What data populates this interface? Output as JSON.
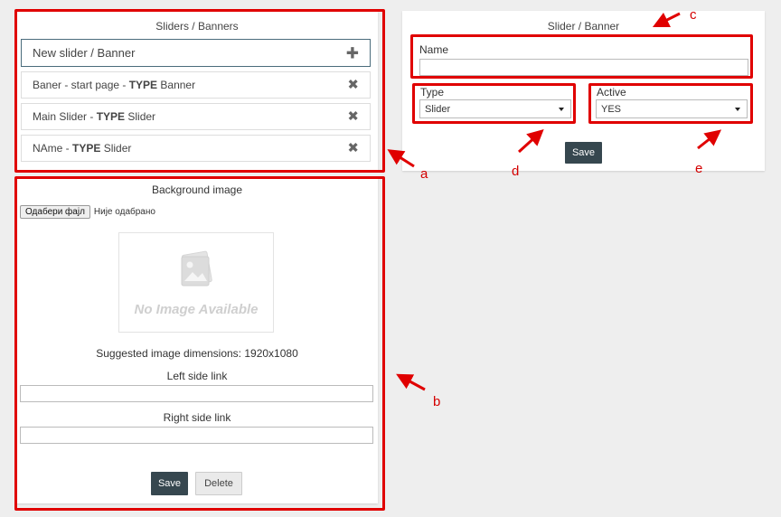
{
  "list_panel": {
    "title": "Sliders / Banners",
    "new_item": {
      "label": "New slider / Banner",
      "icon": "plus-icon"
    },
    "type_keyword": "TYPE",
    "items": [
      {
        "prefix": "Baner - start page - ",
        "type_value": " Banner"
      },
      {
        "prefix": "Main Slider - ",
        "type_value": " Slider"
      },
      {
        "prefix": "NAme - ",
        "type_value": " Slider"
      }
    ],
    "remove_icon": "close-icon"
  },
  "image_panel": {
    "title": "Background image",
    "file_button_label": "Одабери фајл",
    "file_status": "Није одабрано",
    "placeholder_text": "No Image Available",
    "dimensions_text": "Suggested image dimensions: 1920x1080",
    "left_link_label": "Left side link",
    "left_link_value": "",
    "right_link_label": "Right side link",
    "right_link_value": "",
    "save_label": "Save",
    "delete_label": "Delete"
  },
  "edit_panel": {
    "title": "Slider / Banner",
    "name_label": "Name",
    "name_value": "",
    "type_label": "Type",
    "type_selected": "Slider",
    "active_label": "Active",
    "active_selected": "YES",
    "save_label": "Save"
  },
  "annotations": {
    "a": "a",
    "b": "b",
    "c": "c",
    "d": "d",
    "e": "e",
    "color": "#e00000"
  },
  "colors": {
    "background": "#eeeeee",
    "primary_button": "#36474f",
    "highlight_border": "#e00000"
  }
}
